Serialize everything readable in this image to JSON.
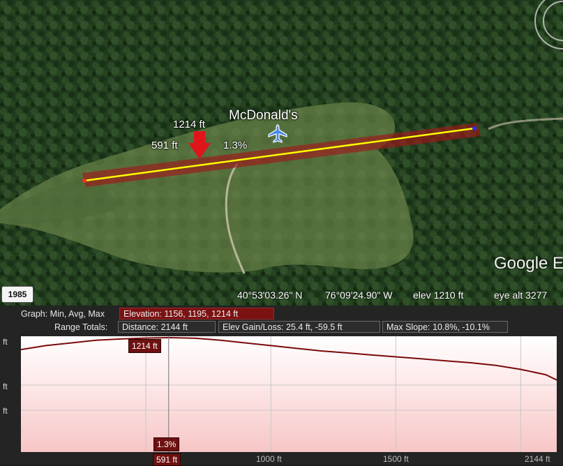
{
  "map": {
    "place_label": "McDonald's",
    "marker": {
      "elevation": "1214 ft",
      "distance": "591 ft",
      "slope": "1.3%"
    },
    "logo_text": "Google Earth"
  },
  "imagery_year": "1985",
  "status_bar": {
    "latitude": "40°53'03.26\" N",
    "longitude": "76°09'24.90\" W",
    "elev": "elev  1210 ft",
    "eye_alt": "eye alt   3277"
  },
  "profile": {
    "graph_label": "Graph: Min, Avg, Max",
    "elevation_stats": "Elevation: 1156, 1195, 1214 ft",
    "range_totals_label": "Range Totals:",
    "distance": "Distance: 2144 ft",
    "elev_gain_loss": "Elev Gain/Loss: 25.4 ft, -59.5 ft",
    "max_slope": "Max Slope: 10.8%, -10.1%",
    "y_axis_unit": "ft",
    "cursor": {
      "elevation_label": "1214 ft",
      "slope_label": "1.3%",
      "distance_label": "591 ft"
    },
    "x_ticks": [
      "1000 ft",
      "1500 ft",
      "2144 ft"
    ]
  },
  "chart_data": {
    "type": "area",
    "xlabel": "",
    "ylabel": "",
    "x": [
      0,
      100,
      200,
      300,
      400,
      500,
      591,
      700,
      800,
      900,
      1000,
      1100,
      1200,
      1300,
      1400,
      1500,
      1600,
      1700,
      1800,
      1900,
      2000,
      2100,
      2144
    ],
    "series": [
      {
        "values": [
          1205,
          1208,
          1210,
          1212,
          1213,
          1213.7,
          1214,
          1213.5,
          1212,
          1210,
          1208,
          1206,
          1204,
          1202.5,
          1201,
          1199.5,
          1198,
          1196.5,
          1195,
          1193,
          1190,
          1186,
          1182
        ]
      }
    ],
    "xlim": [
      0,
      2144
    ],
    "ylim": [
      1156,
      1214
    ],
    "colors": {
      "line": "#7a0a0a",
      "fill": "#f7c6c6"
    }
  }
}
